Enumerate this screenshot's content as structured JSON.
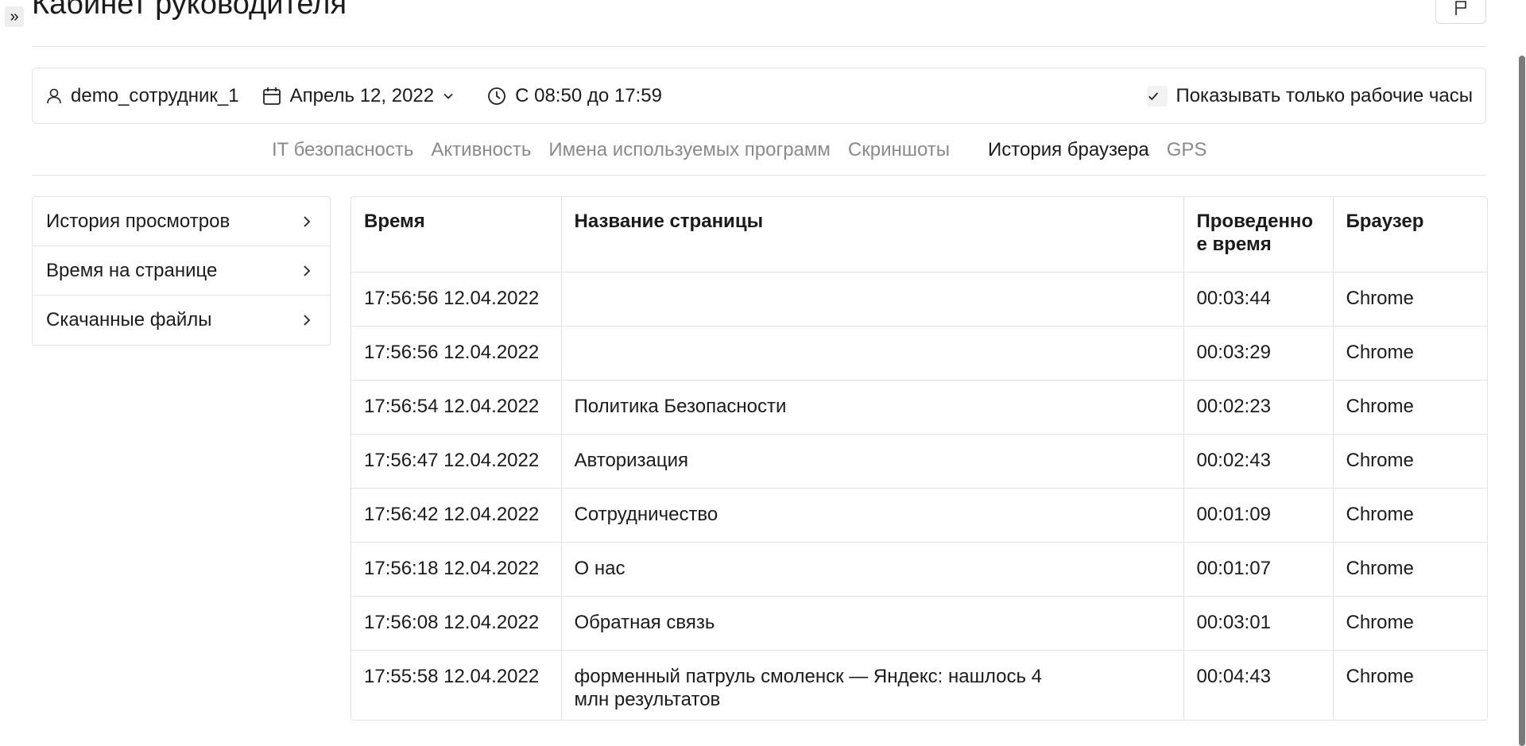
{
  "page": {
    "title": "Кабинет руководителя",
    "expand_glyph": "»"
  },
  "filter_bar": {
    "user": "demo_сотрудник_1",
    "date": "Апрель 12, 2022",
    "time_range": "С 08:50 до 17:59",
    "work_hours_only_label": "Показывать только рабочие часы",
    "work_hours_only_checked": true
  },
  "tabs": [
    {
      "label": "IT безопасность",
      "active": false
    },
    {
      "label": "Активность",
      "active": false
    },
    {
      "label": "Имена используемых программ",
      "active": false
    },
    {
      "label": "Скриншоты",
      "active": false
    },
    {
      "label": "История браузера",
      "active": true
    },
    {
      "label": "GPS",
      "active": false
    }
  ],
  "sidenav": {
    "items": [
      {
        "label": "История просмотров"
      },
      {
        "label": "Время на странице"
      },
      {
        "label": "Скачанные файлы"
      }
    ]
  },
  "table": {
    "columns": {
      "time": "Время",
      "page_title": "Название страницы",
      "duration": "Проведенно е время",
      "browser": "Браузер"
    },
    "rows": [
      {
        "time": "17:56:56 12.04.2022",
        "page_title": "",
        "duration": "00:03:44",
        "browser": "Chrome"
      },
      {
        "time": "17:56:56 12.04.2022",
        "page_title": "",
        "duration": "00:03:29",
        "browser": "Chrome"
      },
      {
        "time": "17:56:54 12.04.2022",
        "page_title": "Политика Безопасности",
        "duration": "00:02:23",
        "browser": "Chrome"
      },
      {
        "time": "17:56:47 12.04.2022",
        "page_title": "Авторизация",
        "duration": "00:02:43",
        "browser": "Chrome"
      },
      {
        "time": "17:56:42 12.04.2022",
        "page_title": "Сотрудничество",
        "duration": "00:01:09",
        "browser": "Chrome"
      },
      {
        "time": "17:56:18 12.04.2022",
        "page_title": "О нас",
        "duration": "00:01:07",
        "browser": "Chrome"
      },
      {
        "time": "17:56:08 12.04.2022",
        "page_title": "Обратная связь",
        "duration": "00:03:01",
        "browser": "Chrome"
      },
      {
        "time": "17:55:58 12.04.2022",
        "page_title": "форменный патруль смоленск — Яндекс: нашлось 4 млн результатов",
        "duration": "00:04:43",
        "browser": "Chrome"
      }
    ]
  },
  "icons": {
    "user": "user-icon",
    "calendar": "calendar-icon",
    "clock": "clock-icon",
    "chevron": "chevron-down-icon",
    "check": "check-icon",
    "feedback": "flag-icon"
  }
}
